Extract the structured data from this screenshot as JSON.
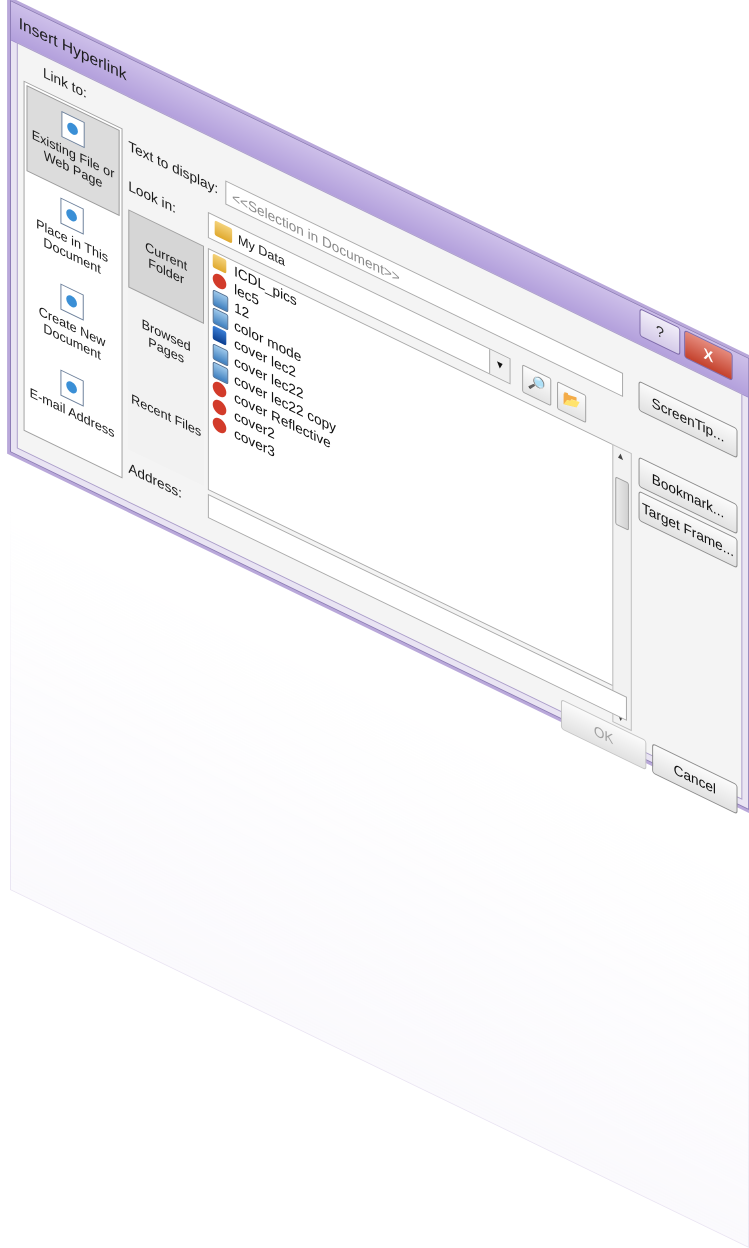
{
  "dialog": {
    "title": "Insert Hyperlink",
    "help_button": "?",
    "close_button": "X"
  },
  "link_to": {
    "label": "Link to:",
    "items": [
      {
        "label": "Existing File or Web Page",
        "icon": "file-globe-icon"
      },
      {
        "label": "Place in This Document",
        "icon": "document-place-icon"
      },
      {
        "label": "Create New Document",
        "icon": "new-document-icon"
      },
      {
        "label": "E-mail Address",
        "icon": "email-icon"
      }
    ]
  },
  "text_to_display": {
    "label": "Text to display:",
    "value": "<<Selection in Document>>"
  },
  "look_in": {
    "label": "Look in:",
    "value": "My Data"
  },
  "nav": {
    "items": [
      "Current Folder",
      "Browsed Pages",
      "Recent Files"
    ]
  },
  "files": [
    {
      "name": "ICDL_pics",
      "type": "folder"
    },
    {
      "name": "lec5",
      "type": "pdf"
    },
    {
      "name": "12",
      "type": "img"
    },
    {
      "name": "color mode",
      "type": "img"
    },
    {
      "name": "cover lec2",
      "type": "dark"
    },
    {
      "name": "cover lec22",
      "type": "img"
    },
    {
      "name": "cover lec22 copy",
      "type": "img"
    },
    {
      "name": "cover Reflective",
      "type": "pdf"
    },
    {
      "name": "cover2",
      "type": "pdf"
    },
    {
      "name": "cover3",
      "type": "pdf"
    }
  ],
  "address": {
    "label": "Address:",
    "value": ""
  },
  "buttons": {
    "screentip": "ScreenTip...",
    "bookmark": "Bookmark...",
    "target_frame": "Target Frame...",
    "ok": "OK",
    "cancel": "Cancel"
  }
}
